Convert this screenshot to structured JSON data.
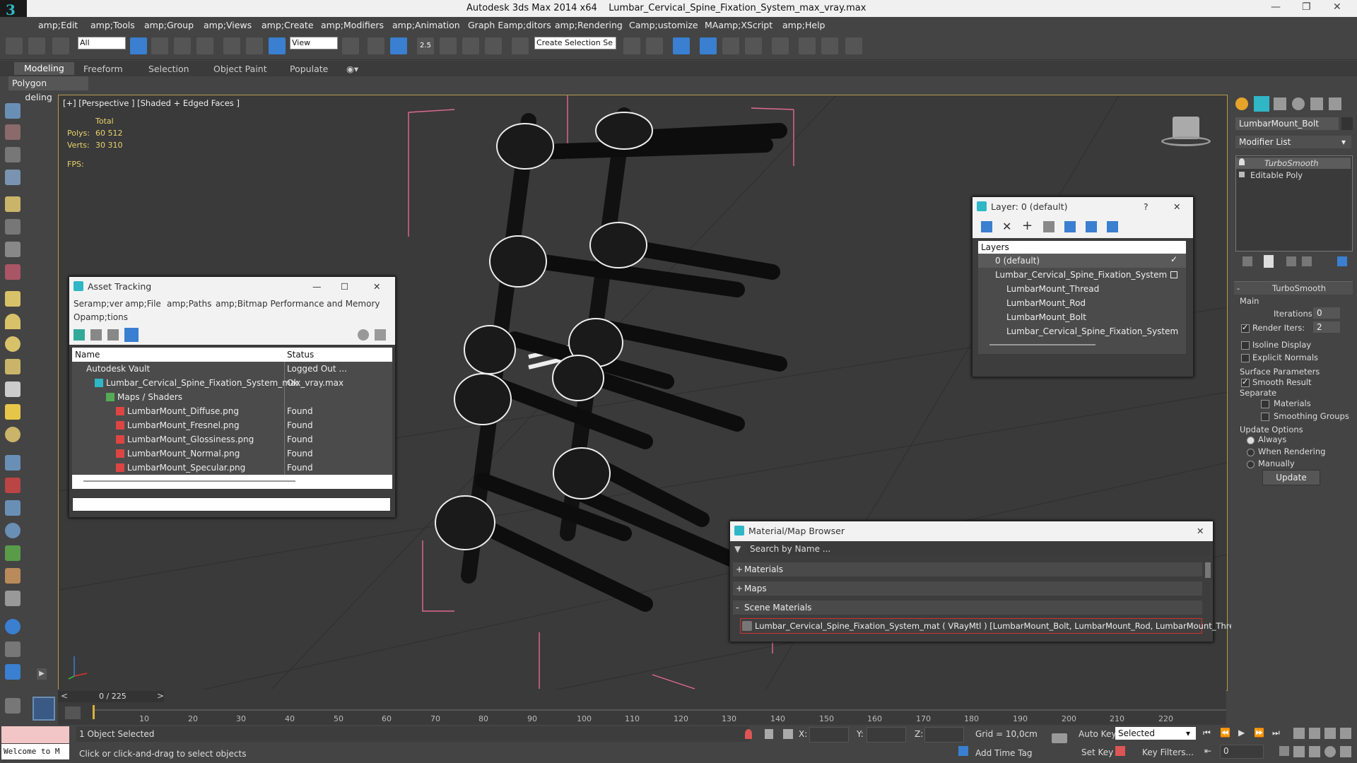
{
  "window": {
    "app_title": "Autodesk 3ds Max  2014 x64",
    "file_title": "Lumbar_Cervical_Spine_Fixation_System_max_vray.max"
  },
  "menu": [
    "amp;Edit",
    "amp;Tools",
    "amp;Group",
    "amp;Views",
    "amp;Create",
    "amp;Modifiers",
    "amp;Animation",
    "Graph Eamp;ditors",
    "amp;Rendering",
    "Camp;ustomize",
    "MAamp;XScript",
    "amp;Help"
  ],
  "toolbar": {
    "filter_value": "All",
    "refcoord_value": "View",
    "selection_set_placeholder": "Create Selection Se",
    "snap_label": "2.5"
  },
  "ribbon": {
    "tabs": [
      "Modeling",
      "Freeform",
      "Selection",
      "Object Paint",
      "Populate"
    ],
    "panel_label": "Polygon Modeling"
  },
  "viewport": {
    "label": "[+] [Perspective ] [Shaded + Edged Faces ]",
    "stats_total_label": "Total",
    "polys_label": "Polys:",
    "polys_value": "60 512",
    "verts_label": "Verts:",
    "verts_value": "30 310",
    "fps_label": "FPS:"
  },
  "asset_tracking": {
    "title": "Asset Tracking",
    "menu": [
      "Seramp;ver",
      "amp;File",
      "amp;Paths",
      "amp;Bitmap Performance and Memory",
      "Opamp;tions"
    ],
    "col_name": "Name",
    "col_status": "Status",
    "rows": [
      {
        "name": "Autodesk Vault",
        "status": "Logged Out ..."
      },
      {
        "name": "Lumbar_Cervical_Spine_Fixation_System_max_vray.max",
        "status": "Ok"
      },
      {
        "name": "Maps / Shaders",
        "status": ""
      },
      {
        "name": "LumbarMount_Diffuse.png",
        "status": "Found"
      },
      {
        "name": "LumbarMount_Fresnel.png",
        "status": "Found"
      },
      {
        "name": "LumbarMount_Glossiness.png",
        "status": "Found"
      },
      {
        "name": "LumbarMount_Normal.png",
        "status": "Found"
      },
      {
        "name": "LumbarMount_Specular.png",
        "status": "Found"
      }
    ]
  },
  "layer_dialog": {
    "title": "Layer: 0 (default)",
    "help": "?",
    "header": "Layers",
    "items": [
      {
        "label": "0 (default)"
      },
      {
        "label": "Lumbar_Cervical_Spine_Fixation_System"
      },
      {
        "label": "LumbarMount_Thread"
      },
      {
        "label": "LumbarMount_Rod"
      },
      {
        "label": "LumbarMount_Bolt"
      },
      {
        "label": "Lumbar_Cervical_Spine_Fixation_System"
      }
    ]
  },
  "material_browser": {
    "title": "Material/Map Browser",
    "search_placeholder": "Search by Name ...",
    "sections": [
      {
        "sign": "+",
        "label": "Materials"
      },
      {
        "sign": "+",
        "label": "Maps"
      },
      {
        "sign": "-",
        "label": "Scene Materials"
      }
    ],
    "scene_material": "Lumbar_Cervical_Spine_Fixation_System_mat  ( VRayMtl ) [LumbarMount_Bolt, LumbarMount_Rod, LumbarMount_Thread]"
  },
  "command_panel": {
    "object_name": "LumbarMount_Bolt",
    "modifier_list": "Modifier List",
    "stack": [
      "TurboSmooth",
      "Editable Poly"
    ],
    "rollout_title": "TurboSmooth",
    "main_label": "Main",
    "iterations_label": "Iterations:",
    "iterations_value": "0",
    "render_iters_label": "Render Iters:",
    "render_iters_value": "2",
    "isoline_label": "Isoline Display",
    "explicit_normals_label": "Explicit Normals",
    "surface_params_label": "Surface Parameters",
    "smooth_result_label": "Smooth Result",
    "separate_label": "Separate",
    "materials_label": "Materials",
    "smoothing_groups_label": "Smoothing Groups",
    "update_options_label": "Update Options",
    "always_label": "Always",
    "when_rendering_label": "When Rendering",
    "manually_label": "Manually",
    "update_button": "Update"
  },
  "timeline": {
    "frame_display": "0 / 225",
    "ticks": [
      "10",
      "20",
      "30",
      "40",
      "50",
      "60",
      "70",
      "80",
      "90",
      "100",
      "110",
      "120",
      "130",
      "140",
      "150",
      "160",
      "170",
      "180",
      "190",
      "200",
      "210",
      "220"
    ]
  },
  "status": {
    "welcome": "Welcome to M",
    "selection": "1 Object Selected",
    "prompt": "Click or click-and-drag to select objects",
    "x_label": "X:",
    "y_label": "Y:",
    "z_label": "Z:",
    "grid": "Grid = 10,0cm",
    "add_time_tag": "Add Time Tag",
    "auto_key": "Auto Key",
    "auto_key_mode": "Selected",
    "set_key": "Set Key",
    "key_filters": "Key Filters...",
    "frame_value": "0"
  },
  "colors": {
    "viewport_border": "#b59a4e",
    "accent": "#2fb7c6",
    "selection_blue": "#3a7fd0",
    "bounding_box": "#e06b8f"
  }
}
